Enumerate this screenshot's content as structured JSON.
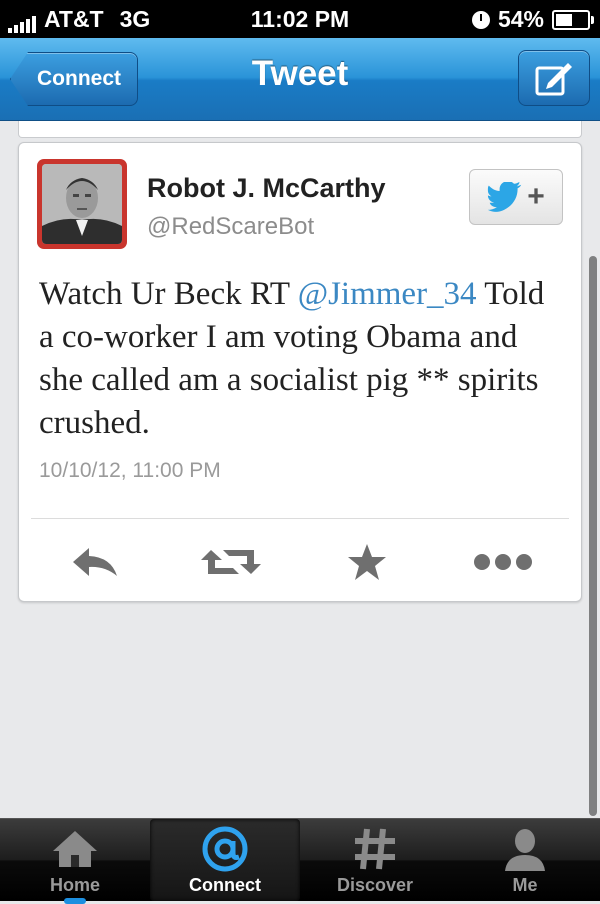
{
  "status_bar": {
    "carrier": "AT&T",
    "network": "3G",
    "time": "11:02 PM",
    "battery": "54%",
    "battery_level": 0.54
  },
  "nav": {
    "back_label": "Connect",
    "title": "Tweet",
    "compose_icon": "compose-icon"
  },
  "tweet": {
    "author_name": "Robot J. McCarthy",
    "author_handle": "@RedScareBot",
    "text_before_mention": "Watch Ur Beck RT ",
    "mention": "@Jimmer_34",
    "text_after_mention": " Told a co-worker I am voting Obama and she called am a socialist pig ** spirits crushed.",
    "timestamp": "10/10/12, 11:00 PM",
    "actions": [
      "reply-icon",
      "retweet-icon",
      "favorite-icon",
      "more-icon"
    ]
  },
  "tab_bar": {
    "tabs": [
      {
        "label": "Home",
        "icon": "home-icon"
      },
      {
        "label": "Connect",
        "icon": "at-icon",
        "selected": true
      },
      {
        "label": "Discover",
        "icon": "hash-icon"
      },
      {
        "label": "Me",
        "icon": "person-icon"
      }
    ]
  },
  "colors": {
    "nav_blue": "#2a93d8",
    "mention_blue": "#3b88c3",
    "twitter_bird": "#2ca6e6",
    "avatar_border": "#c9352d"
  }
}
